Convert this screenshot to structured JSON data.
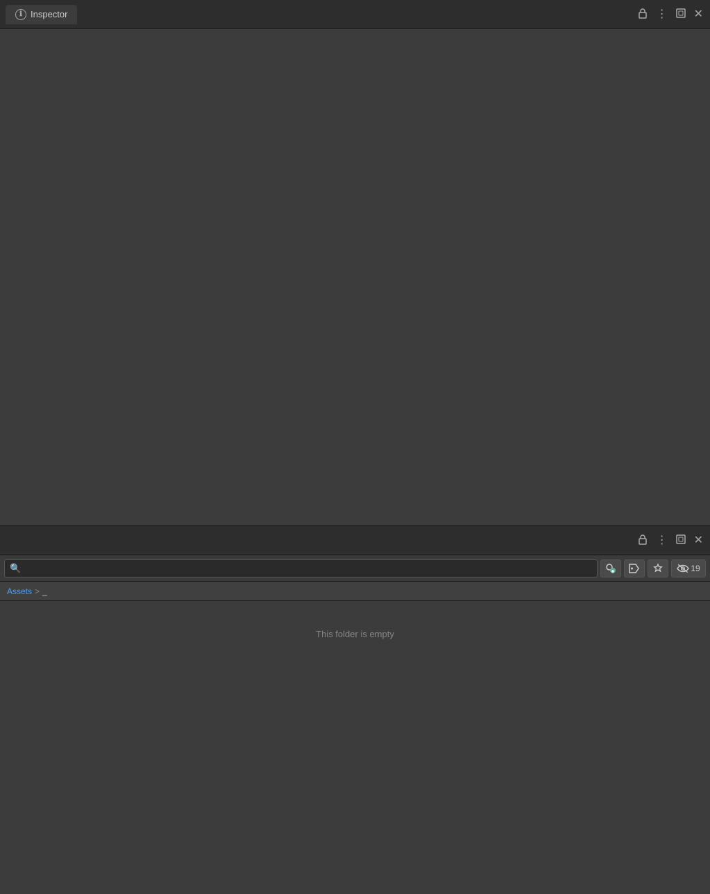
{
  "inspector": {
    "title": "Inspector",
    "tab_label": "Inspector",
    "info_icon": "ℹ",
    "controls": {
      "lock_icon": "🔒",
      "more_icon": "⋮",
      "maximize_icon": "⧉",
      "close_icon": "✕"
    }
  },
  "assets": {
    "controls": {
      "lock_icon": "🔒",
      "more_icon": "⋮",
      "maximize_icon": "⧉",
      "close_icon": "✕"
    },
    "search": {
      "placeholder": "",
      "value": ""
    },
    "toolbar": {
      "filter_types_label": "filter-types",
      "filter_labels_label": "filter-labels",
      "favorites_label": "favorites",
      "hidden_count": "19"
    },
    "breadcrumb": {
      "root": "Assets",
      "separator": ">",
      "current": "_"
    },
    "empty_message": "This folder is empty"
  }
}
